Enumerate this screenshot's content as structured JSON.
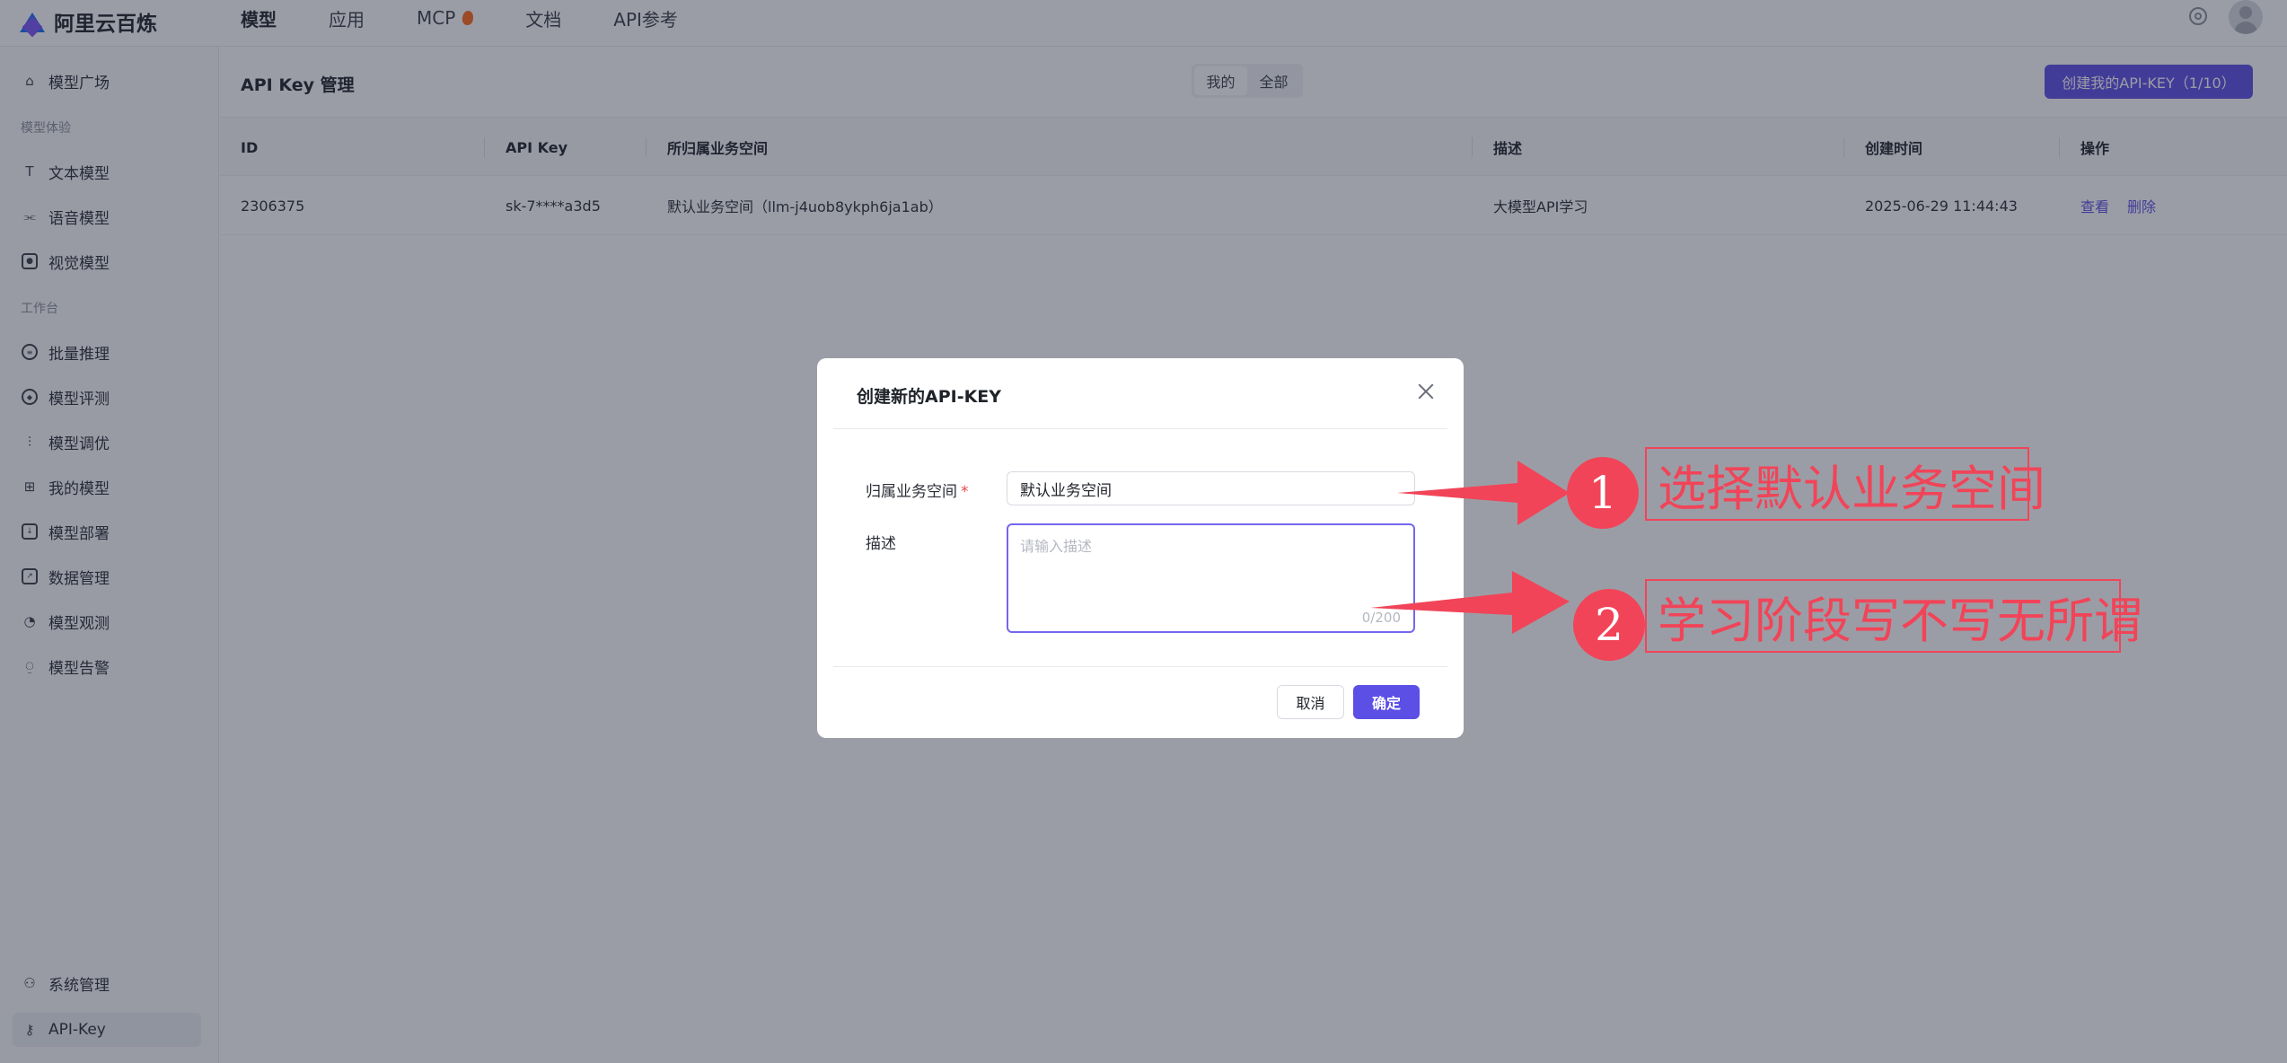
{
  "app": {
    "name": "阿里云百炼"
  },
  "topnav": {
    "items": [
      "模型",
      "应用",
      "MCP",
      "文档",
      "API参考"
    ],
    "active": "模型"
  },
  "sidebar": {
    "model_square": "模型广场",
    "group_experience": "模型体验",
    "text_model": "文本模型",
    "voice_model": "语音模型",
    "vision_model": "视觉模型",
    "group_workbench": "工作台",
    "batch_inference": "批量推理",
    "model_eval": "模型评测",
    "model_tuning": "模型调优",
    "my_models": "我的模型",
    "model_deploy": "模型部署",
    "data_mgmt": "数据管理",
    "model_observe": "模型观测",
    "model_alert": "模型告警",
    "system_mgmt": "系统管理",
    "api_key": "API-Key"
  },
  "page": {
    "title": "API Key 管理",
    "segment": {
      "mine": "我的",
      "all": "全部",
      "selected": "全部"
    },
    "create_button": "创建我的API-KEY（1/10）"
  },
  "table": {
    "headers": [
      "ID",
      "API Key",
      "所归属业务空间",
      "描述",
      "创建时间",
      "操作"
    ],
    "rows": [
      {
        "id": "2306375",
        "api_key": "sk-7****a3d5",
        "workspace": "默认业务空间（llm-j4uob8ykph6ja1ab）",
        "description": "大模型API学习",
        "created": "2025-06-29 11:44:43",
        "actions": [
          "查看",
          "删除"
        ]
      }
    ]
  },
  "modal": {
    "title": "创建新的API-KEY",
    "workspace_label": "归属业务空间",
    "required_mark": "*",
    "workspace_value": "默认业务空间",
    "desc_label": "描述",
    "desc_placeholder": "请输入描述",
    "desc_counter": "0/200",
    "cancel": "取消",
    "ok": "确定"
  },
  "annotations": [
    {
      "number": "1",
      "text": "选择默认业务空间"
    },
    {
      "number": "2",
      "text": "学习阶段写不写无所谓"
    }
  ],
  "colors": {
    "primary": "#5b4fe6",
    "annotation": "#f14458",
    "overlay": "rgba(34,38,58,0.45)"
  }
}
